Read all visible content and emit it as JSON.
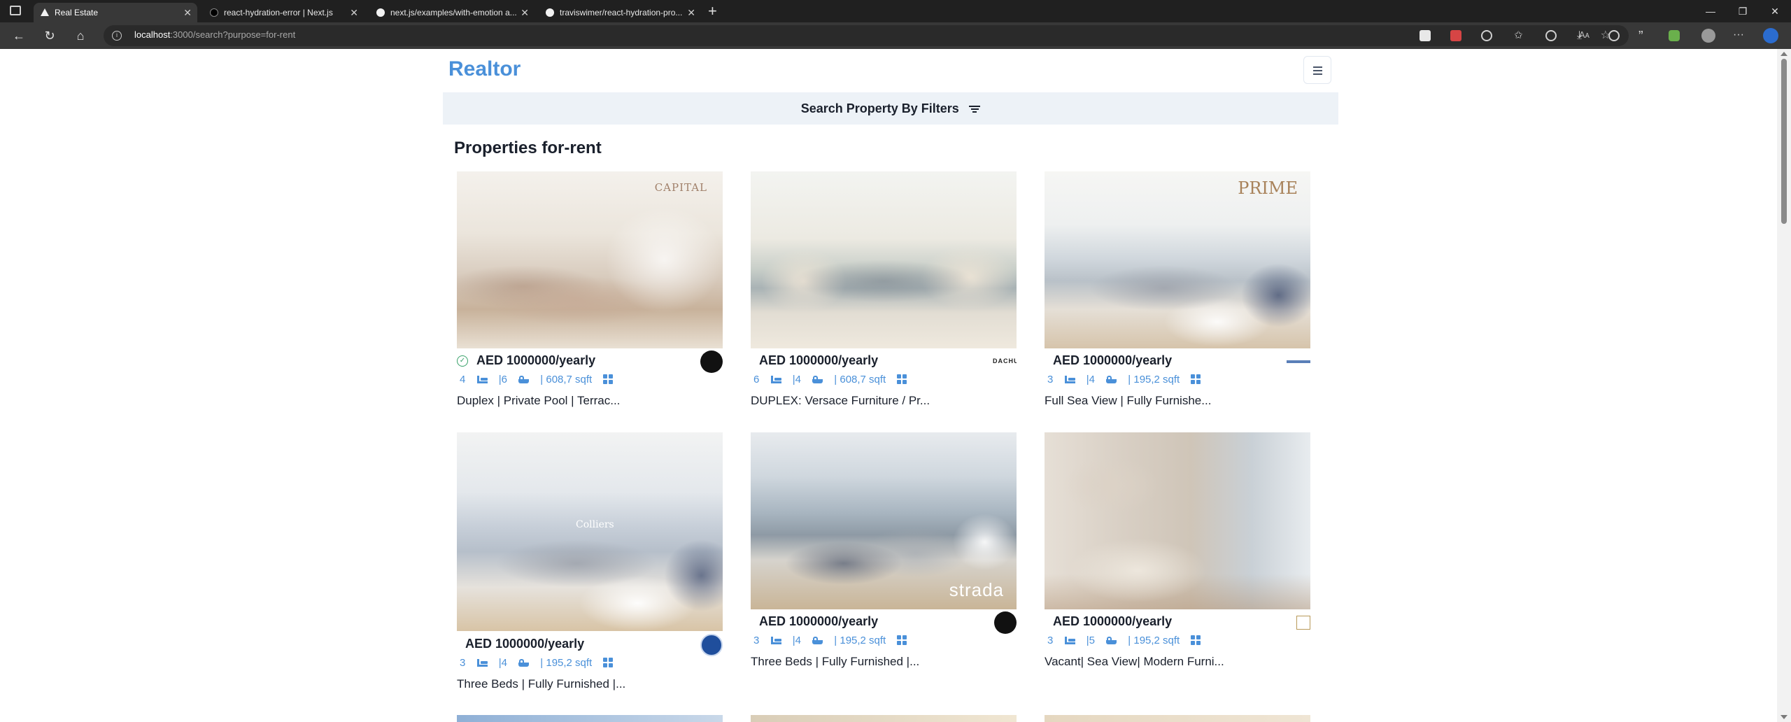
{
  "browser": {
    "tabs": [
      {
        "title": "Real Estate",
        "active": true,
        "icon": "vercel-icon"
      },
      {
        "title": "react-hydration-error | Next.js",
        "active": false,
        "icon": "nextjs-icon"
      },
      {
        "title": "next.js/examples/with-emotion a...",
        "active": false,
        "icon": "github-icon"
      },
      {
        "title": "traviswimer/react-hydration-pro...",
        "active": false,
        "icon": "github-icon"
      }
    ],
    "url_host": "localhost",
    "url_rest": ":3000/search?purpose=for-rent",
    "read_aloud": "Aᴀ"
  },
  "header": {
    "logo": "Realtor",
    "filter_label": "Search Property By Filters"
  },
  "main": {
    "heading": "Properties for-rent",
    "properties": [
      {
        "verified": true,
        "price": "AED 1000000/yearly",
        "rooms": "4",
        "baths": "|6",
        "area": "| 608,7 sqft",
        "title": "Duplex | Private Pool | Terrac...",
        "photo_label": "CAPITAL",
        "agency": "dark"
      },
      {
        "verified": false,
        "price": "AED 1000000/yearly",
        "rooms": "6",
        "baths": "|4",
        "area": "| 608,7 sqft",
        "title": "DUPLEX: Versace Furniture / Pr...",
        "photo_label": "",
        "agency": "DACHU"
      },
      {
        "verified": false,
        "price": "AED 1000000/yearly",
        "rooms": "3",
        "baths": "|4",
        "area": "| 195,2 sqft",
        "title": "Full Sea View | Fully Furnishe...",
        "photo_label": "PRIME",
        "agency": "blueline"
      },
      {
        "verified": false,
        "price": "AED 1000000/yearly",
        "rooms": "3",
        "baths": "|4",
        "area": "| 195,2 sqft",
        "title": "Three Beds | Fully Furnished |...",
        "photo_label": "Colliers",
        "agency": "colliers"
      },
      {
        "verified": false,
        "price": "AED 1000000/yearly",
        "rooms": "3",
        "baths": "|4",
        "area": "| 195,2 sqft",
        "title": "Three Beds | Fully Furnished |...",
        "photo_label": "strada",
        "agency": "strada"
      },
      {
        "verified": false,
        "price": "AED 1000000/yearly",
        "rooms": "3",
        "baths": "|5",
        "area": "| 195,2 sqft",
        "title": "Vacant| Sea View| Modern Furni...",
        "photo_label": "",
        "agency": "lz"
      }
    ]
  },
  "colors": {
    "brand": "#4a90d9",
    "filter_bg": "#edf2f7",
    "text": "#1a202c",
    "verified": "#38a169"
  }
}
